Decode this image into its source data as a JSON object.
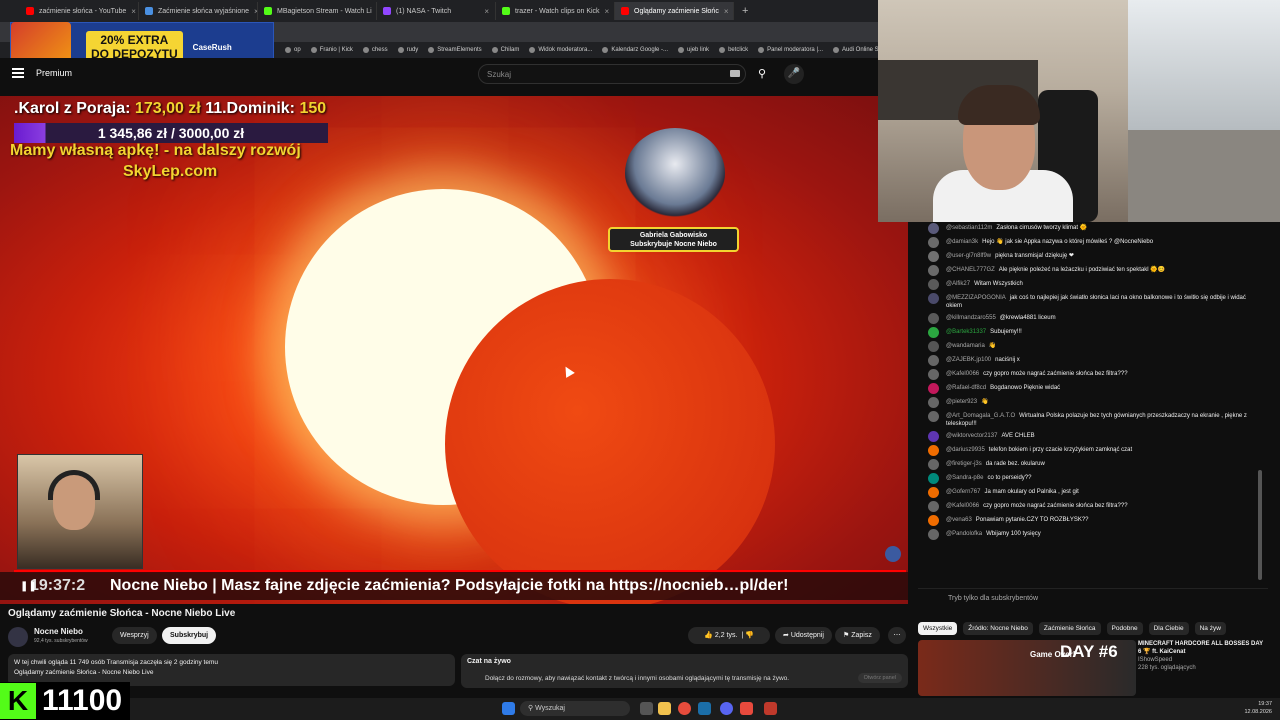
{
  "browser": {
    "tabs": [
      {
        "label": "zaćmienie słońca - YouTube",
        "color": "#ff0000"
      },
      {
        "label": "Zaćmienie słońca wyjaśnione",
        "color": "#4a90e2"
      },
      {
        "label": "MBagietson Stream - Watch Li",
        "color": "#53fc18"
      },
      {
        "label": "(1) NASA - Twitch",
        "color": "#9146ff"
      },
      {
        "label": "trazer - Watch clips on Kick",
        "color": "#53fc18"
      },
      {
        "label": "Oglądamy zaćmienie Słońc",
        "color": "#ff0000",
        "active": true
      }
    ],
    "bookmarks": [
      "op",
      "Franio | Kick",
      "chess",
      "rudy",
      "StreamElements",
      "Chilam",
      "Widok moderatora...",
      "Kalendarz Google -...",
      "ujeb link",
      "betclick",
      "Panel moderatora |...",
      "Audi Online Servi"
    ]
  },
  "ad": {
    "line1": "20% EXTRA",
    "line2": "DO DEPOZYTU",
    "brand": "CaseRush"
  },
  "youtube": {
    "logo": "Premium",
    "search_placeholder": "Szukaj"
  },
  "overlay": {
    "donor_prefix": ".Karol z Poraja: ",
    "donor_amount": "173,00 zł",
    "donor_mid": " 11.Dominik: ",
    "donor_amount2": "150",
    "goal": "1 345,86 zł / 3000,00 zł",
    "promo1": "Mamy własną apkę! - na dalszy rozwój",
    "promo2": "SkyLep.com",
    "sub_line1": "Gabriela Gabowisko",
    "sub_line2": "Subskrybuje Nocne Niebo",
    "ticker_time": "19:37:2",
    "ticker_text": "Nocne Niebo  |  Masz fajne zdjęcie zaćmienia?  Podsyłajcie fotki  na https://nocnieb…pl/der!"
  },
  "video": {
    "title": "Oglądamy zaćmienie Słońca - Nocne Niebo Live",
    "channel": "Nocne Niebo",
    "subscribers": "92,4 tys. subskrybentów",
    "support_label": "Wesprzyj",
    "subscribe_label": "Subskrybuj",
    "likes": "2,2 tys.",
    "share_label": "Udostępnij",
    "save_label": "Zapisz",
    "description_line1": "W tej chwili ogląda 11 749 osób  Transmisja zaczęła się 2 godziny temu",
    "description_line2": "Oglądamy zaćmienie Słońca - Nocne Niebo Live"
  },
  "live_chat_box": {
    "title": "Czat na żywo",
    "text": "Dołącz do rozmowy, aby nawiązać kontakt z twórcą i innymi osobami oglądającymi tę transmisję na żywo.",
    "button": "Otwórz panel"
  },
  "kick": {
    "count": "11100"
  },
  "chat": {
    "messages": [
      {
        "user": "@sebastian112m",
        "text": "Zasłona cirrusów tworzy klimat 🌞",
        "color": "#5a5a7a"
      },
      {
        "user": "@damian3k",
        "text": "Hejo 👋 jak sie Appka nazywa o której mówiłeś ? @NocneNiebo",
        "color": "#6a6a6a"
      },
      {
        "user": "@user-gl7n8lf9w",
        "text": "piękna transmisja! dziękuję ❤",
        "color": "#707070"
      },
      {
        "user": "@CHANEL777GZ",
        "text": "Ale pięknie poleżeć na leżaczku i podziwiać ten spektakl 🌞😊",
        "color": "#6a6a6a"
      },
      {
        "user": "@Alfik27",
        "text": "Witam Wszystkich",
        "color": "#5a5a5a"
      },
      {
        "user": "@MEZZIZAPOGONIA",
        "text": "jak coś to najlepiej jak światło słonica laci na okno balkonowe i to świtło się odbije i widać okiem",
        "color": "#4a4a6a"
      },
      {
        "user": "@killmandzaro555",
        "text": "@krewla4881 liceum",
        "color": "#5a5a5a"
      },
      {
        "user": "@Bartek31337",
        "text": "Subujemy!!!",
        "color": "#2ba640",
        "greenName": true
      },
      {
        "user": "@wandamaria",
        "text": "👋",
        "color": "#555"
      },
      {
        "user": "@ZAJEBK.jp100",
        "text": "naciśnij x",
        "color": "#666"
      },
      {
        "user": "@Kafel0066",
        "text": "czy gopro może nagrać zaćmienie słońca bez filtra???",
        "color": "#666"
      },
      {
        "user": "@Rafael-df8cd",
        "text": "Bogdanowo Pięknie widać",
        "color": "#c2185b"
      },
      {
        "user": "@pieter923",
        "text": "👋",
        "color": "#666"
      },
      {
        "user": "@Art_Domagala_G.A.T.O",
        "text": "Wirtualna Polska polazuje bez tych gównianych przeszkadzaczy na ekranie , piękne z teleskopu!!!",
        "color": "#666"
      },
      {
        "user": "@wiktorvector2137",
        "text": "AVE CHLEB",
        "color": "#5e35b1"
      },
      {
        "user": "@dariusz9935",
        "text": "telefon bokiem i przy czacie krzyżykiem zamknąć czat",
        "color": "#ef6c00"
      },
      {
        "user": "@firetiger-j3s",
        "text": "da rade bez. okularuw",
        "color": "#666"
      },
      {
        "user": "@Sandra-p8e",
        "text": "co to perseidy??",
        "color": "#00897b"
      },
      {
        "user": "@Gofern767",
        "text": "Ja mam okulary od Palnika , jest git",
        "color": "#ef6c00"
      },
      {
        "user": "@Kafel0066",
        "text": "czy gopro może nagrać zaćmienie słońca bez filtra???",
        "color": "#666"
      },
      {
        "user": "@vena63",
        "text": "Ponawiam pytanie.CZY TO ROZBŁYSK??",
        "color": "#ef6c00"
      },
      {
        "user": "@Pandolofka",
        "text": "Wbijamy 100 tysięcy",
        "color": "#666"
      }
    ],
    "input_placeholder": "Tryb tylko dla subskrybentów"
  },
  "related": {
    "chips": [
      "Wszystkie",
      "Źródło: Nocne Niebo",
      "Zaćmienie Słońca",
      "Podobne",
      "Dla Ciebie",
      "Na żyw"
    ],
    "video_title": "MINECRAFT HARDCORE ALL BOSSES DAY 6 🏆 ft. KaiCenat",
    "video_channel": "IShowSpeed",
    "video_meta": "228 tys. oglądających",
    "thumb_day": "DAY #6",
    "thumb_text": "Game Over!"
  },
  "taskbar": {
    "search": "Wyszukaj",
    "time": "19:37",
    "date": "12.08.2026"
  }
}
